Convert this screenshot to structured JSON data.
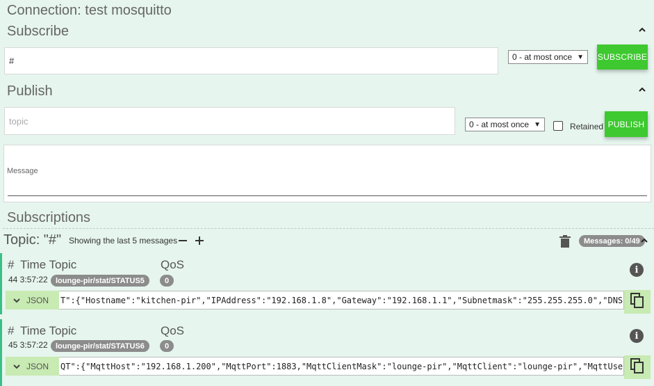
{
  "connection": {
    "title": "Connection: test mosquitto"
  },
  "subscribe": {
    "title": "Subscribe",
    "topic_value": "#",
    "qos": "0 - at most once",
    "button": "SUBSCRIBE"
  },
  "publish": {
    "title": "Publish",
    "topic_placeholder": "topic",
    "qos": "0 - at most once",
    "retained_label": "Retained",
    "button": "PUBLISH",
    "message_label": "Message"
  },
  "subscriptions": {
    "title": "Subscriptions",
    "topic_label": "Topic: \"#\"",
    "showing_text": "Showing the last 5 messages",
    "messages_badge": "Messages: 0/49"
  },
  "messages": [
    {
      "header_hash": "#",
      "header_time_topic": "Time Topic",
      "header_qos": "QoS",
      "index_time": "44 3:57:22",
      "topic": "lounge-pir/stat/STATUS5",
      "qos": "0",
      "format": "JSON",
      "payload": "T\":{\"Hostname\":\"kitchen-pir\",\"IPAddress\":\"192.168.1.8\",\"Gateway\":\"192.168.1.1\",\"Subnetmask\":\"255.255.255.0\",\"DNSSe"
    },
    {
      "header_hash": "#",
      "header_time_topic": "Time Topic",
      "header_qos": "QoS",
      "index_time": "45 3:57:22",
      "topic": "lounge-pir/stat/STATUS6",
      "qos": "0",
      "format": "JSON",
      "payload": "QT\":{\"MqttHost\":\"192.168.1.200\",\"MqttPort\":1883,\"MqttClientMask\":\"lounge-pir\",\"MqttClient\":\"lounge-pir\",\"MqttUser\""
    }
  ],
  "colors": {
    "accent": "#3ec930",
    "background": "#e6f5ee",
    "json_pill": "#c8eab3"
  }
}
